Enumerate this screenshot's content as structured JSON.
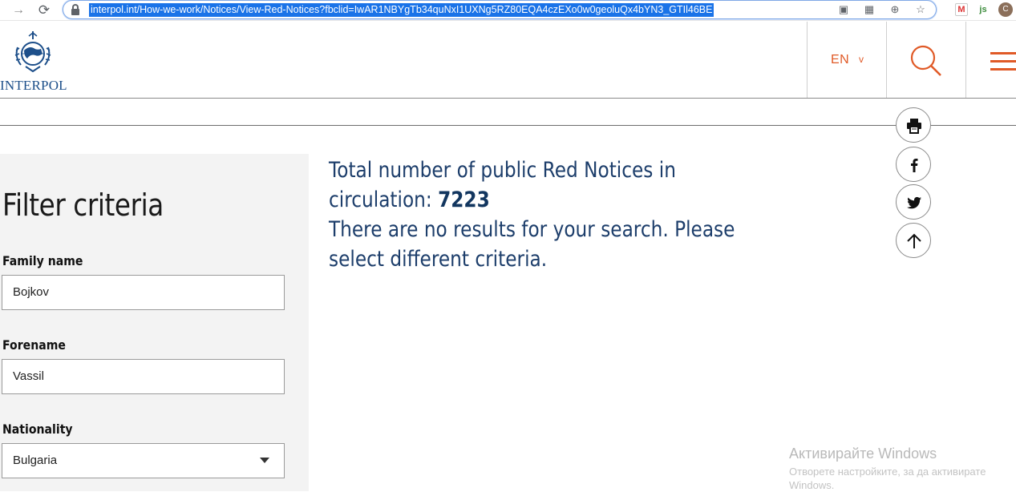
{
  "browser": {
    "url": "interpol.int/How-we-work/Notices/View-Red-Notices?fbclid=IwAR1NBYgTb34quNxI1UXNg5RZ80EQA4czEXo0w0geoluQx4bYN3_GTIl46BE",
    "icons": [
      "forward-icon",
      "reload-icon",
      "lock-icon",
      "cast-icon",
      "translate-icon",
      "zoom-icon",
      "star-icon",
      "gmail-extension-icon",
      "js-extension-icon",
      "profile-avatar"
    ]
  },
  "header": {
    "logo_text": "INTERPOL",
    "language": "EN",
    "language_chevron": "v",
    "colors": {
      "accent": "#e05a27",
      "logo_blue": "#1d4f8a"
    }
  },
  "sidebar": {
    "title": "Filter criteria",
    "fields": [
      {
        "label": "Family name",
        "value": "Bojkov"
      },
      {
        "label": "Forename",
        "value": "Vassil"
      },
      {
        "label": "Nationality",
        "value": "Bulgaria"
      }
    ]
  },
  "main": {
    "total_label": "Total number of public Red Notices in circulation: ",
    "total_count": "7223",
    "no_results": "There are no results for your search. Please select different criteria.",
    "text_color": "#1d3e6b"
  },
  "actions": [
    "print-icon",
    "facebook-icon",
    "twitter-icon",
    "arrow-up-icon"
  ],
  "watermark": {
    "title": "Активирайте Windows",
    "subtitle": "Отворете настройките, за да активирате Windows."
  }
}
